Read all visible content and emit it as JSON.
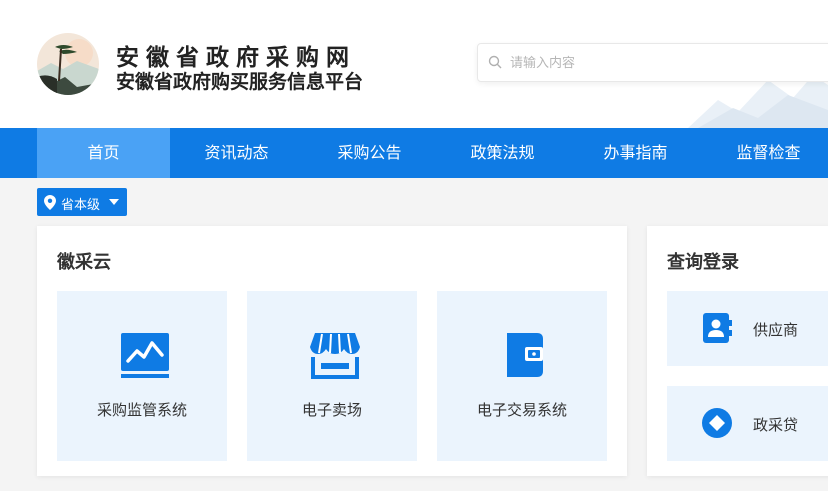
{
  "header": {
    "title": "安徽省政府采购网",
    "subtitle": "安徽省政府购买服务信息平台",
    "search": {
      "placeholder": "请输入内容",
      "value": ""
    }
  },
  "nav": {
    "items": [
      {
        "label": "首页",
        "active": true
      },
      {
        "label": "资讯动态"
      },
      {
        "label": "采购公告"
      },
      {
        "label": "政策法规"
      },
      {
        "label": "办事指南"
      },
      {
        "label": "监督检查"
      }
    ]
  },
  "region": {
    "label": "省本级"
  },
  "huicaiyun": {
    "title": "徽采云",
    "tiles": [
      {
        "label": "采购监管系统",
        "icon": "monitor-chart-icon"
      },
      {
        "label": "电子卖场",
        "icon": "storefront-icon"
      },
      {
        "label": "电子交易系统",
        "icon": "wallet-icon"
      }
    ]
  },
  "query": {
    "title": "查询登录",
    "items": [
      {
        "label": "供应商",
        "icon": "contact-card-icon"
      },
      {
        "label": "政采贷",
        "icon": "diamond-loan-icon"
      }
    ]
  },
  "colors": {
    "primary": "#0f7be4",
    "nav_active": "#4aa2f5",
    "tile_bg": "#ebf4fd"
  }
}
